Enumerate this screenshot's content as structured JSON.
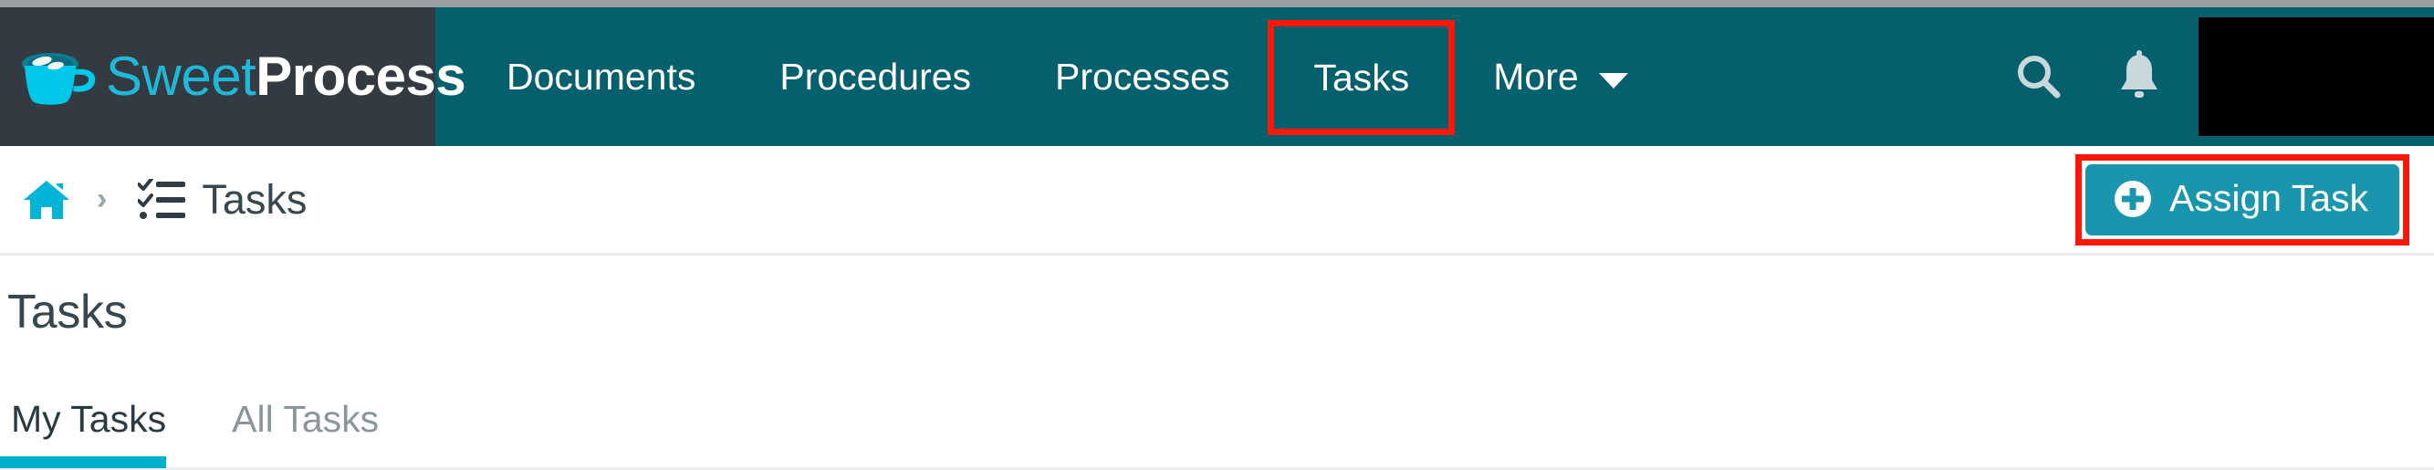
{
  "brand": {
    "logo_icon": "coffee-cup-icon",
    "name_light": "Sweet",
    "name_bold": "Process",
    "cup_color": "#00c8e8",
    "light_text_color": "#1fb8d8",
    "panel_color": "#343a41"
  },
  "navbar": {
    "background": "#04606c",
    "active_indicator_color": "#00d8f0",
    "annotation_color": "#fe1709",
    "items": [
      {
        "label": "Documents",
        "active": false,
        "annotated": false
      },
      {
        "label": "Procedures",
        "active": false,
        "annotated": false
      },
      {
        "label": "Processes",
        "active": false,
        "annotated": false
      },
      {
        "label": "Tasks",
        "active": true,
        "annotated": true
      },
      {
        "label": "More",
        "active": false,
        "annotated": false,
        "has_dropdown": true
      }
    ],
    "right_icons": [
      {
        "name": "search-icon"
      },
      {
        "name": "bell-icon"
      }
    ],
    "avatar": {
      "name": "user-avatar",
      "redacted": true,
      "color": "#000000"
    }
  },
  "breadcrumb": {
    "home_icon": "home-icon",
    "home_color": "#00b4d8",
    "separator": "›",
    "item_icon": "task-list-icon",
    "item_label": "Tasks"
  },
  "assign_task": {
    "icon": "plus-circle-icon",
    "label": "Assign Task",
    "button_color": "#1995ad",
    "annotated": true,
    "annotation_color": "#fe1709"
  },
  "page": {
    "title": "Tasks"
  },
  "tabs": {
    "active_underline_color": "#01b0cd",
    "items": [
      {
        "label": "My Tasks",
        "active": true
      },
      {
        "label": "All Tasks",
        "active": false
      }
    ]
  }
}
